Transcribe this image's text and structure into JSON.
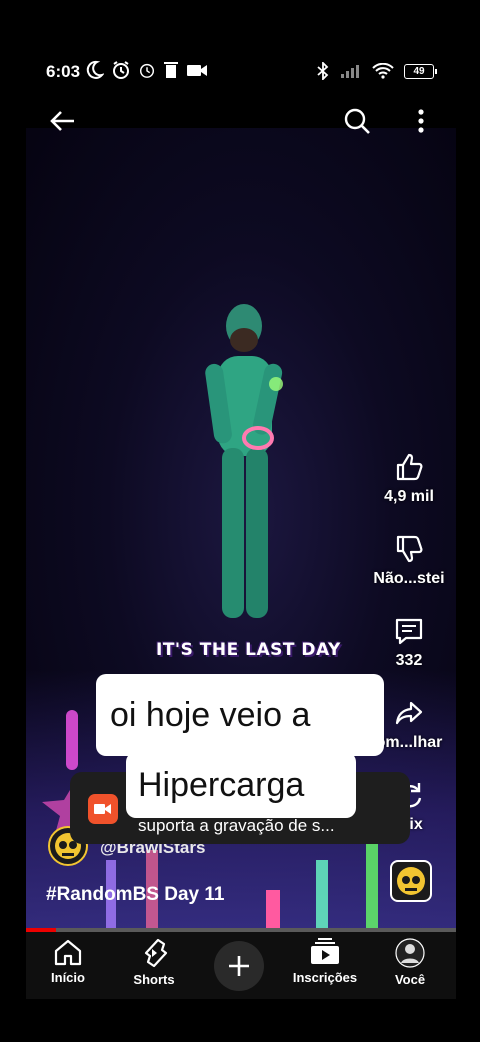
{
  "status_bar": {
    "time": "6:03",
    "battery": "49",
    "icons_left": [
      "moon-icon",
      "alarm-icon",
      "alarm-icon",
      "trash-icon",
      "video-record-icon"
    ],
    "icons_right": [
      "bluetooth-icon",
      "signal-icon",
      "wifi-icon",
      "battery-icon"
    ]
  },
  "top_bar": {
    "icons": [
      "back-arrow-icon",
      "search-icon",
      "more-vertical-icon"
    ]
  },
  "video": {
    "caption": "IT'S THE LAST DAY"
  },
  "actions": {
    "like_count": "4,9 mil",
    "dislike_label": "Não...stei",
    "comments_count": "332",
    "share_label": "om...lhar",
    "remix_label": "mix"
  },
  "channel": {
    "handle": "@BrawlStars"
  },
  "title": "#RandomBS Day 11",
  "progress": {
    "fraction": 0.07
  },
  "nav": {
    "home": "Início",
    "shorts": "Shorts",
    "subscriptions": "Inscrições",
    "you": "Você"
  },
  "toast": {
    "text": "suporta a gravação de s..."
  },
  "bubble": {
    "line1": "oi hoje veio a",
    "line2": "Hipercarga"
  },
  "colors": {
    "accent_red": "#ff0000",
    "toast_icon": "#f0522b",
    "brawl_yellow": "#f2c531"
  }
}
